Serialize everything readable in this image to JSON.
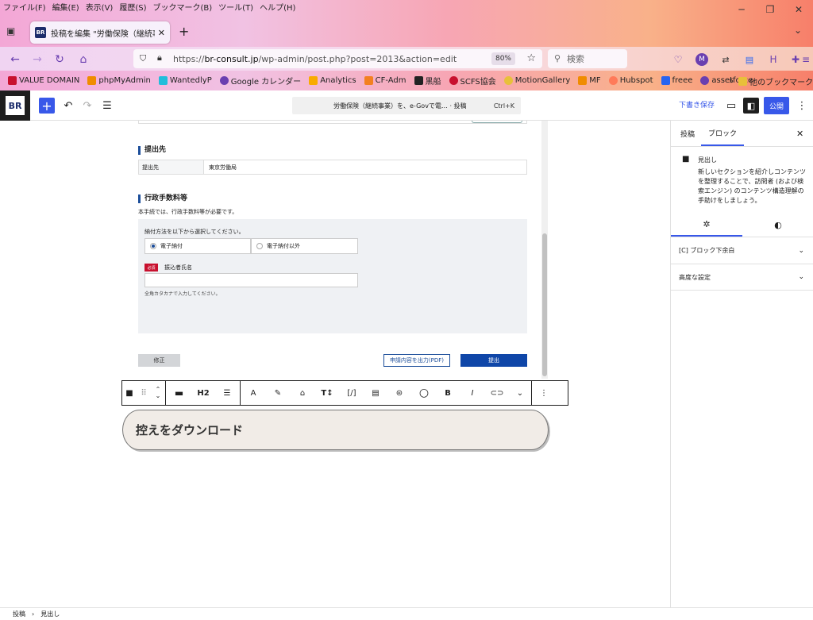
{
  "menubar": [
    "ファイル(F)",
    "編集(E)",
    "表示(V)",
    "履歴(S)",
    "ブックマーク(B)",
    "ツール(T)",
    "ヘルプ(H)"
  ],
  "browser": {
    "tab_title": "投稿を編集 \"労働保険（継続事業",
    "tab_favicon": "BR",
    "url_prefix": "https://",
    "url_domain": "br-consult.jp",
    "url_path": "/wp-admin/post.php?post=2013&action=edit",
    "zoom": "80%",
    "search_placeholder": "検索",
    "bookmarks": [
      {
        "label": "VALUE DOMAIN",
        "color": "#c8102e"
      },
      {
        "label": "phpMyAdmin",
        "color": "#f08c00"
      },
      {
        "label": "WantedlyP",
        "color": "#21bddb"
      },
      {
        "label": "Google カレンダー",
        "color": "#6a3fb0"
      },
      {
        "label": "Analytics",
        "color": "#f9ab00"
      },
      {
        "label": "CF-Adm",
        "color": "#f38020"
      },
      {
        "label": "黒船",
        "color": "#222222"
      },
      {
        "label": "SCFS協会",
        "color": "#c8102e"
      },
      {
        "label": "MotionGallery",
        "color": "#e8c03a"
      },
      {
        "label": "MF",
        "color": "#f08c00"
      },
      {
        "label": "Hubspot",
        "color": "#ff7a59"
      },
      {
        "label": "freee",
        "color": "#2864f0"
      },
      {
        "label": "assetforce",
        "color": "#6a3fb0"
      }
    ],
    "other_bookmarks": "他のブックマーク",
    "profile_initial": "M"
  },
  "wp": {
    "logo": "BR",
    "command_bar": "労働保険（継続事業）を、e-Govで電… · 投稿",
    "command_shortcut": "Ctrl+K",
    "save_draft": "下書き保存",
    "publish": "公開"
  },
  "content": {
    "sec1_title": "提出先",
    "sec1_label": "提出先",
    "sec1_value": "東京労働局",
    "sec2_title": "行政手数料等",
    "sec2_desc": "本手続では、行政手数料等が必要です。",
    "payment_prompt": "納付方法を以下から選択してください。",
    "radio_1": "電子納付",
    "radio_2": "電子納付以外",
    "required_badge": "必須",
    "payer_label": "振込者氏名",
    "payer_hint": "全角カタカナで入力してください。",
    "btn_edit": "修正",
    "btn_pdf": "申請内容を出力(PDF)",
    "btn_submit": "提出"
  },
  "toolbar": {
    "heading_level": "H2",
    "bold": "B",
    "italic": "I",
    "code": "[/]"
  },
  "heading_block": {
    "text": "控えをダウンロード"
  },
  "sidebar": {
    "tab_post": "投稿",
    "tab_block": "ブロック",
    "block_name": "見出し",
    "block_desc": "新しいセクションを紹介しコンテンツを整理することで、訪問者 (および検索エンジン) のコンテンツ構造理解の手助けをしましょう。",
    "panel_1": "[C] ブロック下余白",
    "panel_2": "高度な設定"
  },
  "breadcrumb": [
    "投稿",
    "見出し"
  ],
  "colors": {
    "accent": "#3858e9",
    "brand": "#1c4e9a",
    "required": "#c8102e"
  }
}
